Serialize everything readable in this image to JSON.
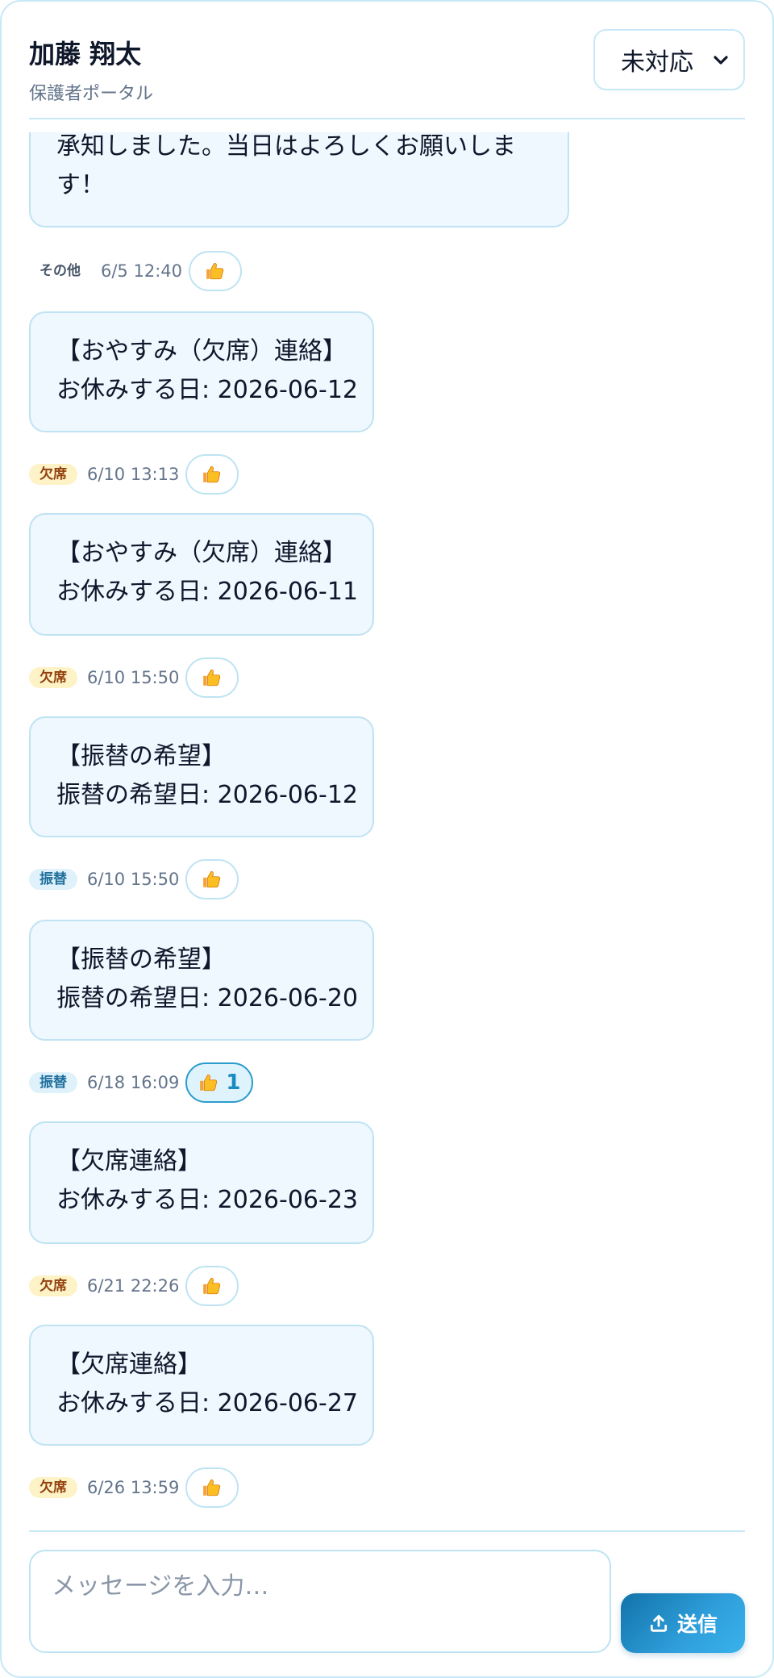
{
  "header": {
    "title": "加藤 翔太",
    "subtitle": "保護者ポータル",
    "status_select": {
      "value": "未対応"
    }
  },
  "messages": [
    {
      "lines": [
        "承知しました。当日はよろしくお願いしま",
        "す！"
      ],
      "tag": "その他",
      "tag_kind": "other",
      "time": "6/5 12:40",
      "reaction_count": null
    },
    {
      "lines": [
        "【おやすみ（欠席）連絡】",
        "お休みする日: 2026-06-12"
      ],
      "tag": "欠席",
      "tag_kind": "absent",
      "time": "6/10 13:13",
      "reaction_count": null
    },
    {
      "lines": [
        "【おやすみ（欠席）連絡】",
        "お休みする日: 2026-06-11"
      ],
      "tag": "欠席",
      "tag_kind": "absent",
      "time": "6/10 15:50",
      "reaction_count": null
    },
    {
      "lines": [
        "【振替の希望】",
        "振替の希望日: 2026-06-12"
      ],
      "tag": "振替",
      "tag_kind": "transfer",
      "time": "6/10 15:50",
      "reaction_count": null
    },
    {
      "lines": [
        "【振替の希望】",
        "振替の希望日: 2026-06-20"
      ],
      "tag": "振替",
      "tag_kind": "transfer",
      "time": "6/18 16:09",
      "reaction_count": "1"
    },
    {
      "lines": [
        "【欠席連絡】",
        "お休みする日: 2026-06-23"
      ],
      "tag": "欠席",
      "tag_kind": "absent",
      "time": "6/21 22:26",
      "reaction_count": null
    },
    {
      "lines": [
        "【欠席連絡】",
        "お休みする日: 2026-06-27"
      ],
      "tag": "欠席",
      "tag_kind": "absent",
      "time": "6/26 13:59",
      "reaction_count": null
    }
  ],
  "composer": {
    "placeholder": "メッセージを入力…",
    "value": "",
    "send_label": "送信"
  },
  "icons": {
    "reaction": "thumbs-up-icon",
    "send": "upload-icon",
    "select": "chevron-down-icon"
  },
  "colors": {
    "accent": "#2f9fdc",
    "border": "#c7e8f6",
    "bubble": "#eff7ff",
    "tag_absent_bg": "#fef3c7",
    "tag_absent_text": "#92400e",
    "tag_transfer_bg": "#dff1fb",
    "tag_transfer_text": "#1f6f9c"
  }
}
